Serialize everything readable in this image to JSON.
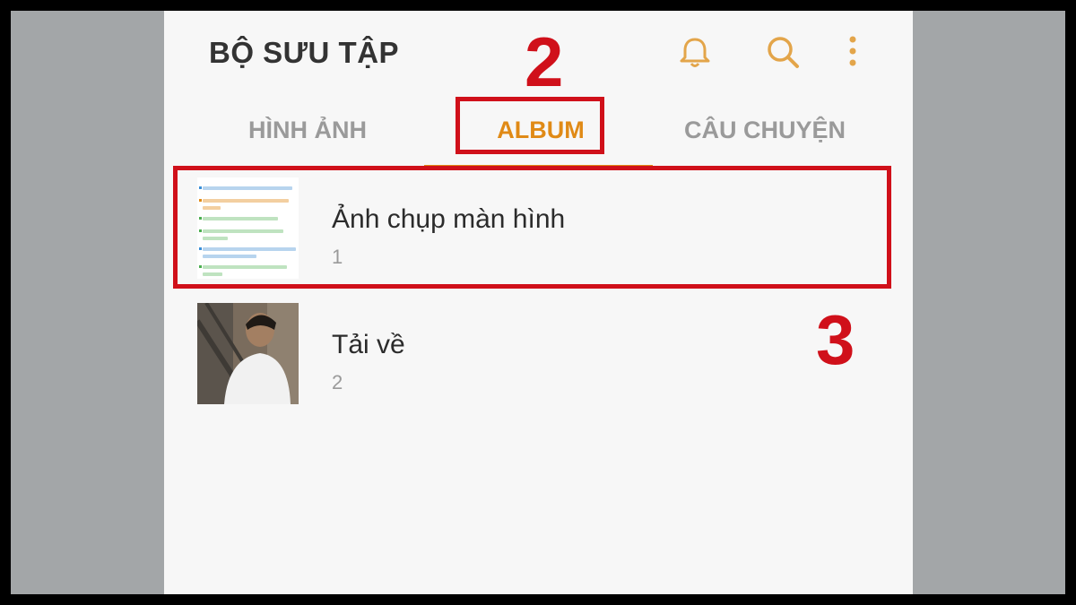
{
  "header": {
    "title": "BỘ SƯU TẬP",
    "icons": [
      "bell-icon",
      "search-icon",
      "more-vertical-icon"
    ]
  },
  "tabs": [
    {
      "label": "HÌNH ẢNH",
      "selected": false
    },
    {
      "label": "ALBUM",
      "selected": true
    },
    {
      "label": "CÂU CHUYỆN",
      "selected": false
    }
  ],
  "albums": [
    {
      "name": "Ảnh chụp màn hình",
      "count": "1",
      "thumbnail": "screenshot-thumbnail"
    },
    {
      "name": "Tải về",
      "count": "2",
      "thumbnail": "photo-thumbnail"
    }
  ],
  "annotations": [
    {
      "number": "2",
      "target": "album-tab"
    },
    {
      "number": "3",
      "target": "album-row-screenshots"
    }
  ],
  "colors": {
    "accent": "#e08a16",
    "annotation": "#d0101a",
    "background": "#f7f7f7",
    "frame": "#a3a6a8"
  }
}
